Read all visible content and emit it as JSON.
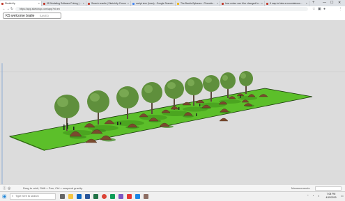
{
  "browser": {
    "tabs": [
      {
        "title": "SketchUp"
      },
      {
        "title": "3D Modeling Software Pricing | ..."
      },
      {
        "title": "Search results | SketchUp Forum"
      },
      {
        "title": "sculpt size (hmm) - Google Search"
      },
      {
        "title": "The Bardic Byhaven - Plumstic..."
      },
      {
        "title": "how colour can it be changed fo..."
      },
      {
        "title": "If map to fake a mountainous..."
      }
    ],
    "new_tab": "+",
    "window_controls": {
      "minimize": "—",
      "maximize": "☐",
      "close": "✕"
    },
    "address": "https://app.sketchup.com/app?hl=en"
  },
  "app": {
    "title": "KS welcome bralie",
    "save_status": "SAVED"
  },
  "statusbar": {
    "hint": "Drag to orbit, Shift = Pan, Ctrl = suspend gravity.",
    "measurements_label": "Measurements"
  },
  "taskbar": {
    "search_placeholder": "Type here to search",
    "time": "7:08 PM",
    "date": "4/19/2019"
  },
  "colors": {
    "ground": "#5cbf2a",
    "ground_edge": "#1a3a0a",
    "sky": "#dcdcdc",
    "mound": "#7a4a2e",
    "tree_canopy": "#5a8a3a"
  }
}
